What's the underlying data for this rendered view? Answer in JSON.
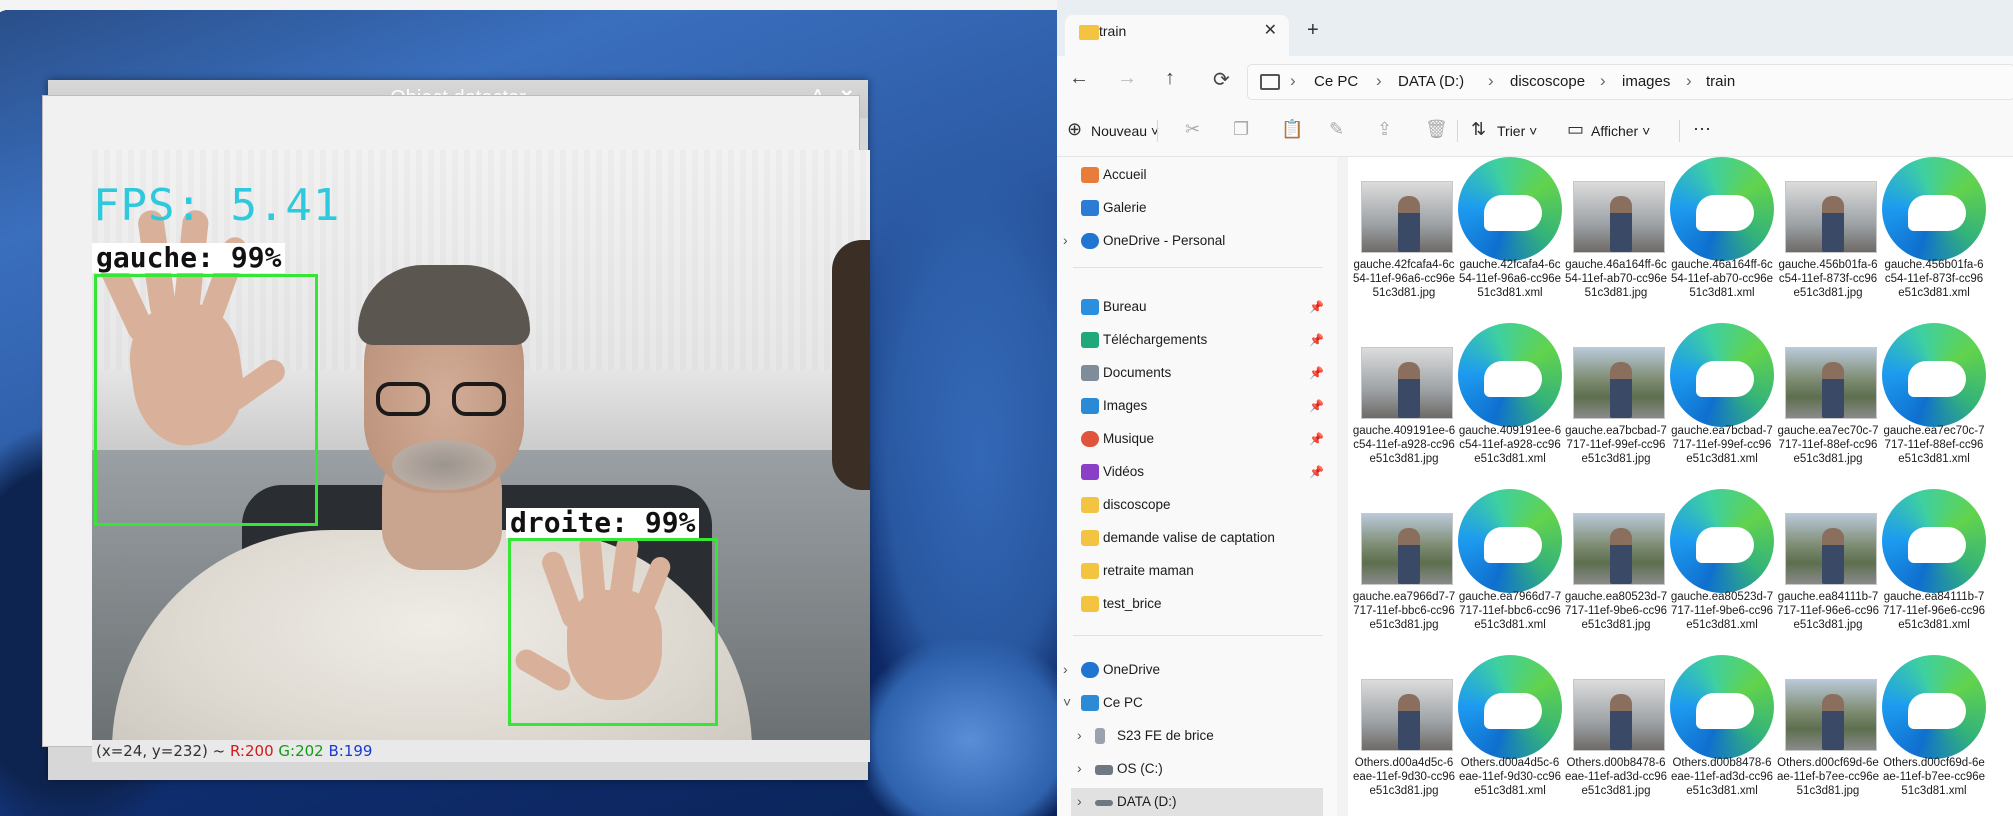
{
  "detector": {
    "window_title": "Object detector",
    "controls": [
      "⌄",
      "˄",
      "✕"
    ],
    "fps_text": "FPS: 5.41",
    "detections": [
      {
        "label": "gauche: 99%"
      },
      {
        "label": "droite: 99%"
      }
    ],
    "status": {
      "coords": "(x=24, y=232) ~",
      "r": "R:200",
      "g": "G:202",
      "b": "B:199"
    },
    "box_color": "#35e635",
    "fps_color": "#2ec9dc"
  },
  "explorer": {
    "tab_title": "train",
    "new_tab": "+",
    "breadcrumbs": [
      "Ce PC",
      "DATA (D:)",
      "discoscope",
      "images",
      "train"
    ],
    "commands": {
      "new": "Nouveau",
      "sort": "Trier",
      "view": "Afficher",
      "more": "···"
    },
    "nav": {
      "home": "Accueil",
      "gallery": "Galerie",
      "onedrive_personal": "OneDrive - Personal",
      "quick": [
        {
          "label": "Bureau",
          "icon": "desktop-icon"
        },
        {
          "label": "Téléchargements",
          "icon": "download-icon"
        },
        {
          "label": "Documents",
          "icon": "documents-icon"
        },
        {
          "label": "Images",
          "icon": "images-icon"
        },
        {
          "label": "Musique",
          "icon": "music-icon"
        },
        {
          "label": "Vidéos",
          "icon": "videos-icon"
        }
      ],
      "folders": [
        "discoscope",
        "demande valise de captation",
        "retraite maman",
        "test_brice"
      ],
      "onedrive": "OneDrive",
      "this_pc": "Ce PC",
      "drives": [
        "S23 FE de brice",
        "OS (C:)",
        "DATA (D:)"
      ]
    },
    "files": [
      {
        "name": "gauche.42fcafa4-6c54-11ef-96a6-cc96e51c3d81.jpg",
        "kind": "photo"
      },
      {
        "name": "gauche.42fcafa4-6c54-11ef-96a6-cc96e51c3d81.xml",
        "kind": "edge"
      },
      {
        "name": "gauche.46a164ff-6c54-11ef-ab70-cc96e51c3d81.jpg",
        "kind": "photo"
      },
      {
        "name": "gauche.46a164ff-6c54-11ef-ab70-cc96e51c3d81.xml",
        "kind": "edge"
      },
      {
        "name": "gauche.456b01fa-6c54-11ef-873f-cc96e51c3d81.jpg",
        "kind": "photo"
      },
      {
        "name": "gauche.456b01fa-6c54-11ef-873f-cc96e51c3d81.xml",
        "kind": "edge"
      },
      {
        "name": "gauche.409191ee-6c54-11ef-a928-cc96e51c3d81.jpg",
        "kind": "photo"
      },
      {
        "name": "gauche.409191ee-6c54-11ef-a928-cc96e51c3d81.xml",
        "kind": "edge"
      },
      {
        "name": "gauche.ea7bcbad-7717-11ef-99ef-cc96e51c3d81.jpg",
        "kind": "outdoor"
      },
      {
        "name": "gauche.ea7bcbad-7717-11ef-99ef-cc96e51c3d81.xml",
        "kind": "edge"
      },
      {
        "name": "gauche.ea7ec70c-7717-11ef-88ef-cc96e51c3d81.jpg",
        "kind": "outdoor"
      },
      {
        "name": "gauche.ea7ec70c-7717-11ef-88ef-cc96e51c3d81.xml",
        "kind": "edge"
      },
      {
        "name": "gauche.ea7966d7-7717-11ef-bbc6-cc96e51c3d81.jpg",
        "kind": "outdoor"
      },
      {
        "name": "gauche.ea7966d7-7717-11ef-bbc6-cc96e51c3d81.xml",
        "kind": "edge"
      },
      {
        "name": "gauche.ea80523d-7717-11ef-9be6-cc96e51c3d81.jpg",
        "kind": "outdoor"
      },
      {
        "name": "gauche.ea80523d-7717-11ef-9be6-cc96e51c3d81.xml",
        "kind": "edge"
      },
      {
        "name": "gauche.ea84111b-7717-11ef-96e6-cc96e51c3d81.jpg",
        "kind": "outdoor"
      },
      {
        "name": "gauche.ea84111b-7717-11ef-96e6-cc96e51c3d81.xml",
        "kind": "edge"
      },
      {
        "name": "Others.d00a4d5c-6eae-11ef-9d30-cc96e51c3d81.jpg",
        "kind": "photo"
      },
      {
        "name": "Others.d00a4d5c-6eae-11ef-9d30-cc96e51c3d81.xml",
        "kind": "edge"
      },
      {
        "name": "Others.d00b8478-6eae-11ef-ad3d-cc96e51c3d81.jpg",
        "kind": "photo"
      },
      {
        "name": "Others.d00b8478-6eae-11ef-ad3d-cc96e51c3d81.xml",
        "kind": "edge"
      },
      {
        "name": "Others.d00cf69d-6eae-11ef-b7ee-cc96e51c3d81.jpg",
        "kind": "outdoor"
      },
      {
        "name": "Others.d00cf69d-6eae-11ef-b7ee-cc96e51c3d81.xml",
        "kind": "edge"
      }
    ]
  }
}
